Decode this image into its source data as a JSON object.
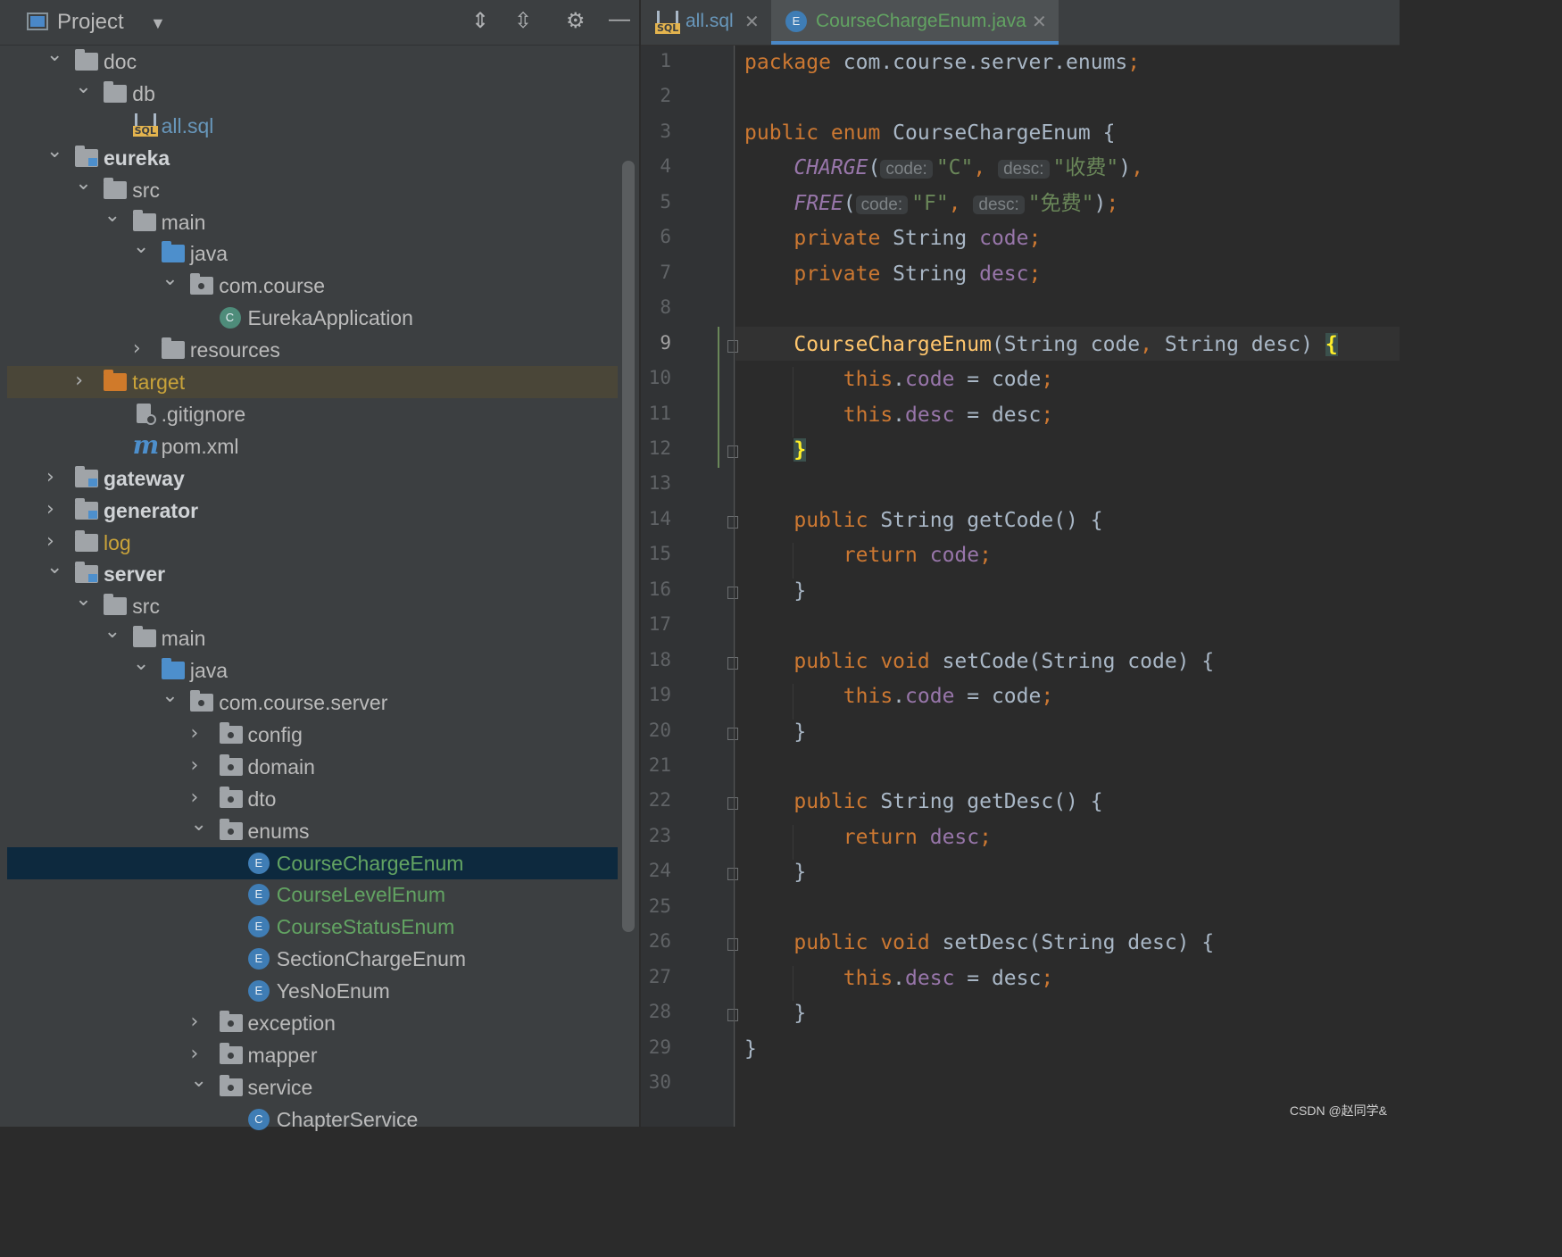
{
  "project_panel": {
    "title": "Project",
    "tree": [
      {
        "label": "doc",
        "expanded": true,
        "icon": "folder",
        "level": 1,
        "color": "#bbbbbb"
      },
      {
        "label": "db",
        "expanded": true,
        "icon": "folder",
        "level": 2,
        "color": "#bbbbbb"
      },
      {
        "label": "all.sql",
        "icon": "sql-file",
        "level": 3,
        "color": "#6897bb"
      },
      {
        "label": "eureka",
        "expanded": true,
        "icon": "module-folder",
        "level": 1,
        "color": "#d0d3d6",
        "bold": true
      },
      {
        "label": "src",
        "expanded": true,
        "icon": "folder",
        "level": 2,
        "color": "#bbbbbb"
      },
      {
        "label": "main",
        "expanded": true,
        "icon": "folder",
        "level": 3,
        "color": "#bbbbbb"
      },
      {
        "label": "java",
        "expanded": true,
        "icon": "source-folder",
        "level": 4,
        "color": "#bbbbbb"
      },
      {
        "label": "com.course",
        "expanded": true,
        "icon": "package",
        "level": 5,
        "color": "#bbbbbb"
      },
      {
        "label": "EurekaApplication",
        "icon": "spring-class",
        "level": 6,
        "color": "#bbbbbb"
      },
      {
        "label": "resources",
        "expanded": false,
        "icon": "resources-folder",
        "level": 4,
        "color": "#bbbbbb"
      },
      {
        "label": "target",
        "expanded": false,
        "icon": "excluded-folder",
        "level": 2,
        "color": "#c9a33a",
        "highlight": true
      },
      {
        "label": ".gitignore",
        "icon": "gitignore-file",
        "level": 3,
        "color": "#bbbbbb"
      },
      {
        "label": "pom.xml",
        "icon": "maven-file",
        "level": 3,
        "color": "#bbbbbb"
      },
      {
        "label": "gateway",
        "expanded": false,
        "icon": "module-folder",
        "level": 1,
        "color": "#d0d3d6",
        "bold": true
      },
      {
        "label": "generator",
        "expanded": false,
        "icon": "module-folder",
        "level": 1,
        "color": "#d0d3d6",
        "bold": true
      },
      {
        "label": "log",
        "expanded": false,
        "icon": "folder",
        "level": 1,
        "color": "#c9a33a"
      },
      {
        "label": "server",
        "expanded": true,
        "icon": "module-folder",
        "level": 1,
        "color": "#d0d3d6",
        "bold": true
      },
      {
        "label": "src",
        "expanded": true,
        "icon": "folder",
        "level": 2,
        "color": "#bbbbbb"
      },
      {
        "label": "main",
        "expanded": true,
        "icon": "folder",
        "level": 3,
        "color": "#bbbbbb"
      },
      {
        "label": "java",
        "expanded": true,
        "icon": "source-folder",
        "level": 4,
        "color": "#bbbbbb"
      },
      {
        "label": "com.course.server",
        "expanded": true,
        "icon": "package",
        "level": 5,
        "color": "#bbbbbb"
      },
      {
        "label": "config",
        "expanded": false,
        "icon": "package",
        "level": 6,
        "color": "#bbbbbb"
      },
      {
        "label": "domain",
        "expanded": false,
        "icon": "package",
        "level": 6,
        "color": "#bbbbbb"
      },
      {
        "label": "dto",
        "expanded": false,
        "icon": "package",
        "level": 6,
        "color": "#bbbbbb"
      },
      {
        "label": "enums",
        "expanded": true,
        "icon": "package",
        "level": 6,
        "color": "#bbbbbb"
      },
      {
        "label": "CourseChargeEnum",
        "icon": "enum",
        "level": 7,
        "color": "#62a362",
        "selected": true
      },
      {
        "label": "CourseLevelEnum",
        "icon": "enum",
        "level": 7,
        "color": "#62a362"
      },
      {
        "label": "CourseStatusEnum",
        "icon": "enum",
        "level": 7,
        "color": "#62a362"
      },
      {
        "label": "SectionChargeEnum",
        "icon": "enum",
        "level": 7,
        "color": "#bbbbbb"
      },
      {
        "label": "YesNoEnum",
        "icon": "enum",
        "level": 7,
        "color": "#bbbbbb"
      },
      {
        "label": "exception",
        "expanded": false,
        "icon": "package",
        "level": 6,
        "color": "#bbbbbb"
      },
      {
        "label": "mapper",
        "expanded": false,
        "icon": "package",
        "level": 6,
        "color": "#bbbbbb"
      },
      {
        "label": "service",
        "expanded": true,
        "icon": "package",
        "level": 6,
        "color": "#bbbbbb"
      },
      {
        "label": "ChapterService",
        "icon": "class",
        "level": 7,
        "color": "#bbbbbb"
      }
    ]
  },
  "tabs": [
    {
      "label": "all.sql",
      "icon": "sql-file",
      "active": false,
      "color": "#6897bb"
    },
    {
      "label": "CourseChargeEnum.java",
      "icon": "enum",
      "active": true,
      "color": "#62a362"
    }
  ],
  "editor": {
    "current_line": 9,
    "line_count": 30,
    "lines": [
      [
        [
          "kw",
          "package "
        ],
        [
          "gray",
          "com.course.server.enums"
        ],
        [
          "kw",
          ";"
        ]
      ],
      [],
      [
        [
          "kw",
          "public enum "
        ],
        [
          "gray",
          "CourseChargeEnum {"
        ]
      ],
      [
        [
          "ind4",
          ""
        ],
        [
          "ital",
          "CHARGE"
        ],
        [
          "gray",
          "("
        ],
        [
          "hint",
          "code:"
        ],
        [
          "str",
          "\"C\""
        ],
        [
          "kw",
          ", "
        ],
        [
          "hint",
          "desc:"
        ],
        [
          "str",
          "\"收费\""
        ],
        [
          "gray",
          ")"
        ],
        [
          "kw",
          ","
        ]
      ],
      [
        [
          "ind4",
          ""
        ],
        [
          "ital",
          "FREE"
        ],
        [
          "gray",
          "("
        ],
        [
          "hint",
          "code:"
        ],
        [
          "str",
          "\"F\""
        ],
        [
          "kw",
          ", "
        ],
        [
          "hint",
          "desc:"
        ],
        [
          "str",
          "\"免费\""
        ],
        [
          "gray",
          ")"
        ],
        [
          "kw",
          ";"
        ]
      ],
      [
        [
          "ind4",
          ""
        ],
        [
          "kw",
          "private "
        ],
        [
          "gray",
          "String "
        ],
        [
          "fld",
          "code"
        ],
        [
          "kw",
          ";"
        ]
      ],
      [
        [
          "ind4",
          ""
        ],
        [
          "kw",
          "private "
        ],
        [
          "gray",
          "String "
        ],
        [
          "fld",
          "desc"
        ],
        [
          "kw",
          ";"
        ]
      ],
      [],
      [
        [
          "ind4",
          ""
        ],
        [
          "fn",
          "CourseChargeEnum"
        ],
        [
          "gray",
          "(String code"
        ],
        [
          "kw",
          ", "
        ],
        [
          "gray",
          "String desc) "
        ],
        [
          "brace",
          "{"
        ]
      ],
      [
        [
          "ind8",
          ""
        ],
        [
          "kw",
          "this"
        ],
        [
          "gray",
          "."
        ],
        [
          "fld",
          "code"
        ],
        [
          "gray",
          " = code"
        ],
        [
          "kw",
          ";"
        ]
      ],
      [
        [
          "ind8",
          ""
        ],
        [
          "kw",
          "this"
        ],
        [
          "gray",
          "."
        ],
        [
          "fld",
          "desc"
        ],
        [
          "gray",
          " = desc"
        ],
        [
          "kw",
          ";"
        ]
      ],
      [
        [
          "ind4",
          ""
        ],
        [
          "brace",
          "}"
        ]
      ],
      [],
      [
        [
          "ind4",
          ""
        ],
        [
          "kw",
          "public "
        ],
        [
          "gray",
          "String "
        ],
        [
          "fn2",
          "getCode"
        ],
        [
          "gray",
          "() {"
        ]
      ],
      [
        [
          "ind8",
          ""
        ],
        [
          "kw",
          "return "
        ],
        [
          "fld",
          "code"
        ],
        [
          "kw",
          ";"
        ]
      ],
      [
        [
          "ind4",
          ""
        ],
        [
          "gray",
          "}"
        ]
      ],
      [],
      [
        [
          "ind4",
          ""
        ],
        [
          "kw",
          "public void "
        ],
        [
          "fn2",
          "setCode"
        ],
        [
          "gray",
          "(String code) {"
        ]
      ],
      [
        [
          "ind8",
          ""
        ],
        [
          "kw",
          "this"
        ],
        [
          "gray",
          "."
        ],
        [
          "fld",
          "code"
        ],
        [
          "gray",
          " = code"
        ],
        [
          "kw",
          ";"
        ]
      ],
      [
        [
          "ind4",
          ""
        ],
        [
          "gray",
          "}"
        ]
      ],
      [],
      [
        [
          "ind4",
          ""
        ],
        [
          "kw",
          "public "
        ],
        [
          "gray",
          "String "
        ],
        [
          "fn2",
          "getDesc"
        ],
        [
          "gray",
          "() {"
        ]
      ],
      [
        [
          "ind8",
          ""
        ],
        [
          "kw",
          "return "
        ],
        [
          "fld",
          "desc"
        ],
        [
          "kw",
          ";"
        ]
      ],
      [
        [
          "ind4",
          ""
        ],
        [
          "gray",
          "}"
        ]
      ],
      [],
      [
        [
          "ind4",
          ""
        ],
        [
          "kw",
          "public void "
        ],
        [
          "fn2",
          "setDesc"
        ],
        [
          "gray",
          "(String desc) {"
        ]
      ],
      [
        [
          "ind8",
          ""
        ],
        [
          "kw",
          "this"
        ],
        [
          "gray",
          "."
        ],
        [
          "fld",
          "desc"
        ],
        [
          "gray",
          " = desc"
        ],
        [
          "kw",
          ";"
        ]
      ],
      [
        [
          "ind4",
          ""
        ],
        [
          "gray",
          "}"
        ]
      ],
      [
        [
          "gray",
          "}"
        ]
      ],
      []
    ],
    "fold_markers": [
      9,
      12,
      14,
      16,
      18,
      20,
      22,
      24,
      26,
      28
    ]
  },
  "watermark": "CSDN @赵同学&"
}
